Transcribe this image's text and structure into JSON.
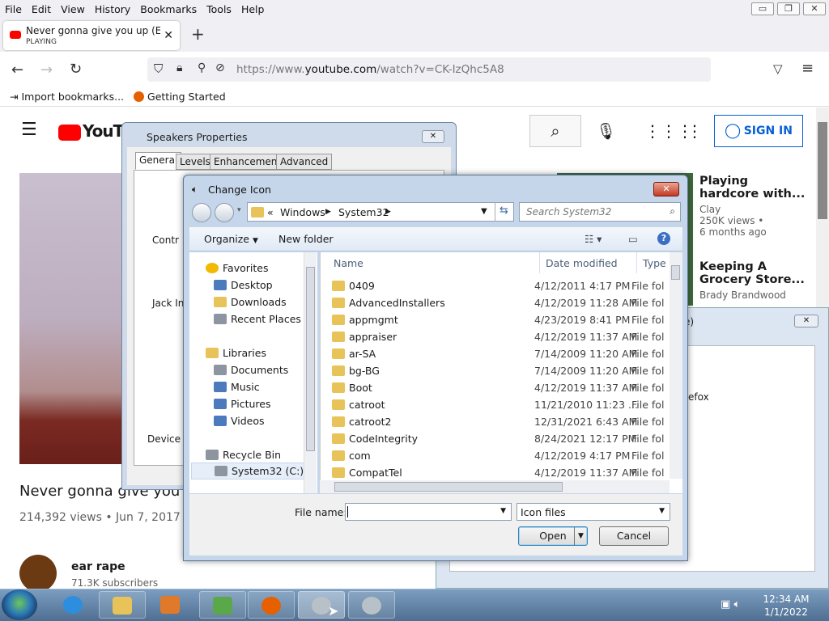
{
  "firefox": {
    "menu": [
      "File",
      "Edit",
      "View",
      "History",
      "Bookmarks",
      "Tools",
      "Help"
    ],
    "tab": {
      "title": "Never gonna give you up (Earra",
      "status": "PLAYING"
    },
    "url": {
      "prefix": "https://www.",
      "domain": "youtube.com",
      "path": "/watch?v=CK-IzQhc5A8"
    },
    "bookmarks": [
      "Import bookmarks...",
      "Getting Started"
    ]
  },
  "youtube": {
    "logo": "YouTube",
    "signin": "SIGN IN",
    "video_title": "Never gonna give you up",
    "views": "214,392 views • Jun 7, 2017",
    "channel": "ear rape",
    "subscribers": "71.3K subscribers",
    "recs": [
      {
        "title1": "Playing",
        "title2": "hardcore with...",
        "by": "Clay",
        "views": "250K views •",
        "age": "6 months ago"
      },
      {
        "title1": "Keeping A",
        "title2": "Grocery Store...",
        "by": "Brady Brandwood"
      }
    ],
    "bg_dialog_fragments": [
      "e)",
      "efox"
    ]
  },
  "speakers": {
    "title": "Speakers Properties",
    "tabs": [
      "General",
      "Levels",
      "Enhancements",
      "Advanced"
    ],
    "labels": [
      "Contr",
      "Jack In",
      "Device"
    ]
  },
  "change_icon": {
    "title": "Change Icon",
    "path": [
      "«",
      "Windows",
      "System32"
    ],
    "search_placeholder": "Search System32",
    "toolbar": {
      "organize": "Organize",
      "new_folder": "New folder"
    },
    "nav": {
      "favorites": "Favorites",
      "fav_items": [
        "Desktop",
        "Downloads",
        "Recent Places"
      ],
      "libraries": "Libraries",
      "lib_items": [
        "Documents",
        "Music",
        "Pictures",
        "Videos"
      ],
      "recycle": "Recycle Bin",
      "drive": "System32 (C:)"
    },
    "columns": {
      "name": "Name",
      "date": "Date modified",
      "type": "Type"
    },
    "files": [
      {
        "name": "0409",
        "date": "4/12/2011 4:17 PM",
        "type": "File fol"
      },
      {
        "name": "AdvancedInstallers",
        "date": "4/12/2019 11:28 AM",
        "type": "File fol"
      },
      {
        "name": "appmgmt",
        "date": "4/23/2019 8:41 PM",
        "type": "File fol"
      },
      {
        "name": "appraiser",
        "date": "4/12/2019 11:37 AM",
        "type": "File fol"
      },
      {
        "name": "ar-SA",
        "date": "7/14/2009 11:20 AM",
        "type": "File fol"
      },
      {
        "name": "bg-BG",
        "date": "7/14/2009 11:20 AM",
        "type": "File fol"
      },
      {
        "name": "Boot",
        "date": "4/12/2019 11:37 AM",
        "type": "File fol"
      },
      {
        "name": "catroot",
        "date": "11/21/2010 11:23 ...",
        "type": "File fol"
      },
      {
        "name": "catroot2",
        "date": "12/31/2021 6:43 AM",
        "type": "File fol"
      },
      {
        "name": "CodeIntegrity",
        "date": "8/24/2021 12:17 PM",
        "type": "File fol"
      },
      {
        "name": "com",
        "date": "4/12/2019 4:17 PM",
        "type": "File fol"
      },
      {
        "name": "CompatTel",
        "date": "4/12/2019 11:37 AM",
        "type": "File fol"
      }
    ],
    "file_name_label": "File name:",
    "file_name_value": "",
    "file_type": "Icon files",
    "open": "Open",
    "cancel": "Cancel"
  },
  "taskbar": {
    "time": "12:34 AM",
    "date": "1/1/2022"
  }
}
